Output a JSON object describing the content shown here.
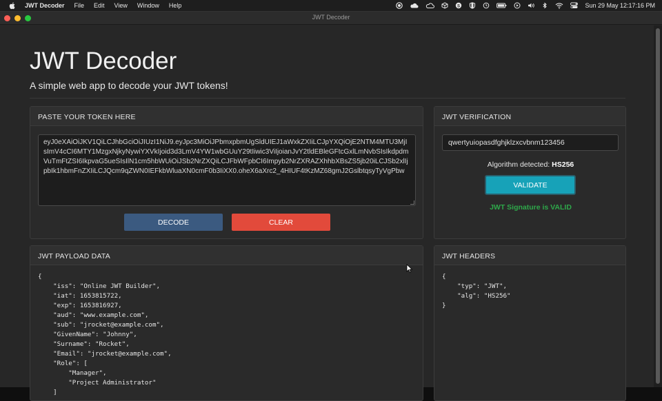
{
  "menubar": {
    "app_name": "JWT Decoder",
    "menus": [
      "File",
      "Edit",
      "View",
      "Window",
      "Help"
    ],
    "clock": "Sun 29 May  12:17:16 PM",
    "status_icons": [
      "record-icon",
      "cloud-icon",
      "cloud-icon",
      "box-icon",
      "skype-icon",
      "shield-icon",
      "time-machine-icon",
      "battery-icon",
      "play-icon",
      "volume-icon",
      "bluetooth-icon",
      "wifi-icon",
      "control-center-icon"
    ]
  },
  "window": {
    "title": "JWT Decoder"
  },
  "header": {
    "title": "JWT Decoder",
    "subtitle": "A simple web app to decode your JWT tokens!"
  },
  "token_panel": {
    "heading": "PASTE YOUR TOKEN HERE",
    "token": "eyJ0eXAiOiJKV1QiLCJhbGciOiJIUzI1NiJ9.eyJpc3MiOiJPbmxpbmUgSldUIEJ1aWxkZXIiLCJpYXQiOjE2NTM4MTU3MjIsImV4cCI6MTY1MzgxNjkyNywiYXVkIjoid3d3LmV4YW1wbGUuY29tIiwic3ViIjoianJvY2tldEBleGFtcGxlLmNvbSIsIkdpdmVuTmFtZSI6IkpvaG5ueSIsIlN1cm5hbWUiOiJSb2NrZXQiLCJFbWFpbCI6Impyb2NrZXRAZXhhbXBsZS5jb20iLCJSb2xlIjpbIk1hbmFnZXIiLCJQcm9qZWN0IEFkbWluaXN0cmF0b3IiXX0.oheX6aXrc2_4HIUF4tKzMZ68gmJ2GslbtqsyTyVgPbw",
    "decode_label": "DECODE",
    "clear_label": "CLEAR"
  },
  "verify_panel": {
    "heading": "JWT VERIFICATION",
    "secret": "qwertyuiopasdfghjklzxcvbnm123456",
    "algo_prefix": "Algorithm detected: ",
    "algo_value": "HS256",
    "validate_label": "VALIDATE",
    "result": "JWT Signature is VALID",
    "result_color": "#2ea84a"
  },
  "payload_panel": {
    "heading": "JWT PAYLOAD DATA",
    "json_text": "{\n    \"iss\": \"Online JWT Builder\",\n    \"iat\": 1653815722,\n    \"exp\": 1653816927,\n    \"aud\": \"www.example.com\",\n    \"sub\": \"jrocket@example.com\",\n    \"GivenName\": \"Johnny\",\n    \"Surname\": \"Rocket\",\n    \"Email\": \"jrocket@example.com\",\n    \"Role\": [\n        \"Manager\",\n        \"Project Administrator\"\n    ]"
  },
  "headers_panel": {
    "heading": "JWT HEADERS",
    "json_text": "{\n    \"typ\": \"JWT\",\n    \"alg\": \"HS256\"\n}"
  },
  "colors": {
    "decode_button": "#3b5a80",
    "clear_button": "#e24a3b",
    "validate_button": "#17a2b8"
  }
}
